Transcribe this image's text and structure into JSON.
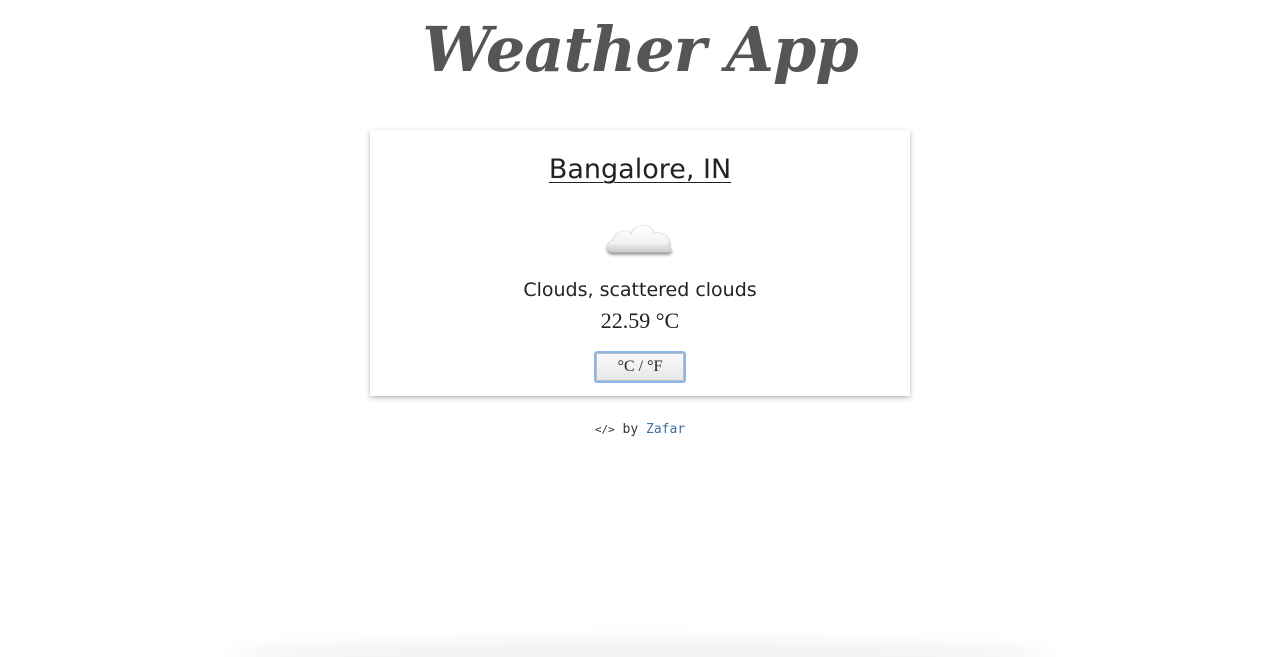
{
  "app": {
    "title": "Weather App"
  },
  "weather": {
    "location": "Bangalore, IN",
    "icon": "cloud-icon",
    "description": "Clouds, scattered clouds",
    "temperature": "22.59 °C",
    "toggle_label": "°C / °F"
  },
  "footer": {
    "code_symbol": "</>",
    "by_text": "by",
    "author": "Zafar"
  },
  "colors": {
    "title": "#575454",
    "link": "#3a6fa0",
    "toggle_border": "#8ab8ea"
  }
}
